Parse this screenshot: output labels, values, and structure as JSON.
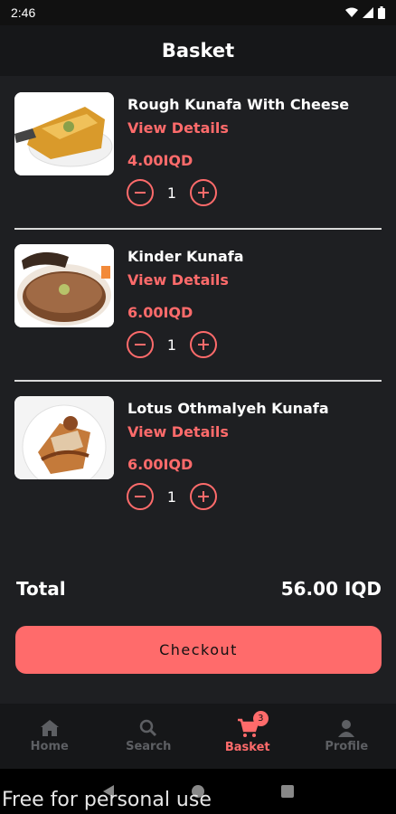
{
  "status_bar": {
    "time": "2:46"
  },
  "header": {
    "title": "Basket"
  },
  "items": [
    {
      "name": "Rough Kunafa With Cheese",
      "link": "View Details",
      "price": "4.00IQD",
      "qty": "1"
    },
    {
      "name": "Kinder Kunafa",
      "link": "View Details",
      "price": "6.00IQD",
      "qty": "1"
    },
    {
      "name": "Lotus Othmalyeh Kunafa",
      "link": "View Details",
      "price": "6.00IQD",
      "qty": "1"
    }
  ],
  "summary": {
    "total_label": "Total",
    "total_value": "56.00 IQD"
  },
  "checkout_label": "Checkout",
  "nav": {
    "home": "Home",
    "search": "Search",
    "basket": "Basket",
    "basket_badge": "3",
    "profile": "Profile"
  },
  "watermark": "Free for personal use",
  "colors": {
    "accent": "#ff6b6b",
    "background": "#1e1f22",
    "bar": "#161719"
  }
}
